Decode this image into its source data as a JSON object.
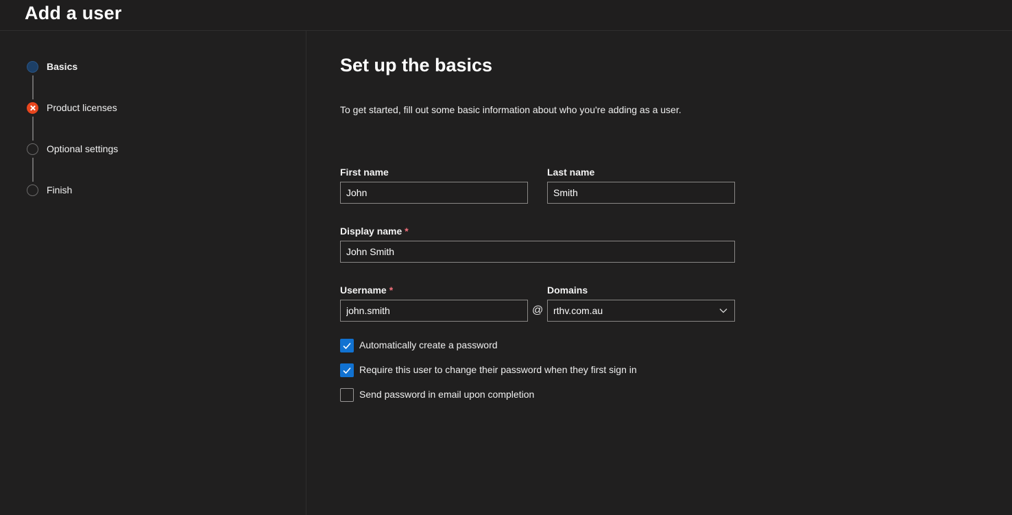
{
  "header": {
    "title": "Add a user"
  },
  "steps": [
    {
      "label": "Basics",
      "state": "current"
    },
    {
      "label": "Product licenses",
      "state": "error"
    },
    {
      "label": "Optional settings",
      "state": "pending"
    },
    {
      "label": "Finish",
      "state": "pending"
    }
  ],
  "main": {
    "title": "Set up the basics",
    "description": "To get started, fill out some basic information about who you're adding as a user."
  },
  "form": {
    "first_name": {
      "label": "First name",
      "value": "John"
    },
    "last_name": {
      "label": "Last name",
      "value": "Smith"
    },
    "display_name": {
      "label": "Display name",
      "required_mark": "*",
      "value": "John Smith"
    },
    "username": {
      "label": "Username",
      "required_mark": "*",
      "value": "john.smith"
    },
    "at_sign": "@",
    "domains": {
      "label": "Domains",
      "value": "rthv.com.au"
    }
  },
  "checkboxes": [
    {
      "label": "Automatically create a password",
      "checked": true
    },
    {
      "label": "Require this user to change their password when they first sign in",
      "checked": true
    },
    {
      "label": "Send password in email upon completion",
      "checked": false
    }
  ],
  "icons": {
    "step_error": "close-icon",
    "dropdown": "chevron-down-icon",
    "check": "checkmark-icon"
  },
  "colors": {
    "accent": "#1172d1",
    "error": "#e8461e",
    "required": "#f1707b",
    "background": "#201f1f"
  }
}
